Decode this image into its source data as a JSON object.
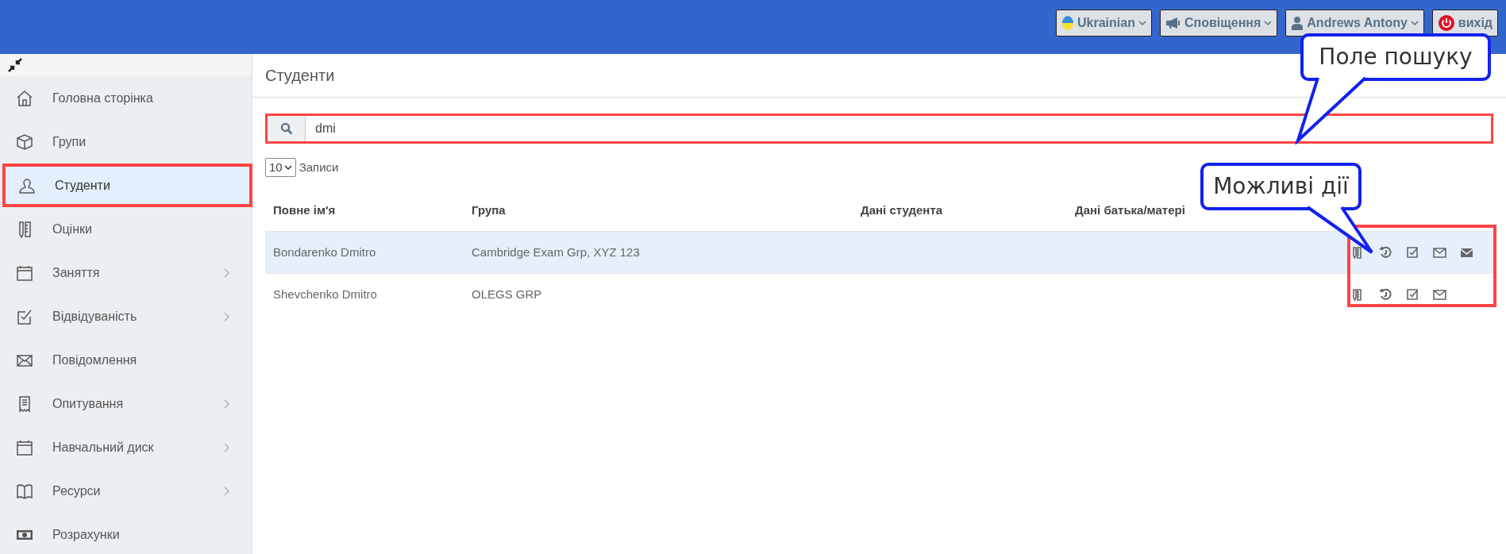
{
  "top_bar": {
    "buttons": [
      {
        "kind": "language",
        "label": "Ukrainian",
        "dropdown": true
      },
      {
        "kind": "notifications",
        "label": "Сповіщення",
        "dropdown": true
      },
      {
        "kind": "user",
        "label": "Andrews Antony",
        "dropdown": true
      },
      {
        "kind": "logout",
        "label": "вихід",
        "dropdown": false
      }
    ]
  },
  "sidebar": {
    "items": [
      {
        "kind": "home",
        "label": "Головна сторінка",
        "submenu": false,
        "selected": false,
        "highlighted": false
      },
      {
        "kind": "box",
        "label": "Групи",
        "submenu": false,
        "selected": false,
        "highlighted": false
      },
      {
        "kind": "user",
        "label": "Студенти",
        "submenu": false,
        "selected": true,
        "highlighted": true
      },
      {
        "kind": "grades",
        "label": "Оцінки",
        "submenu": false,
        "selected": false,
        "highlighted": false
      },
      {
        "kind": "calendar",
        "label": "Заняття",
        "submenu": true,
        "selected": false,
        "highlighted": false
      },
      {
        "kind": "check",
        "label": "Відвідуваність",
        "submenu": true,
        "selected": false,
        "highlighted": false
      },
      {
        "kind": "mail",
        "label": "Повідомлення",
        "submenu": false,
        "selected": false,
        "highlighted": false
      },
      {
        "kind": "receipt",
        "label": "Опитування",
        "submenu": true,
        "selected": false,
        "highlighted": false
      },
      {
        "kind": "calendar",
        "label": "Навчальний диск",
        "submenu": true,
        "selected": false,
        "highlighted": false
      },
      {
        "kind": "book",
        "label": "Ресурси",
        "submenu": true,
        "selected": false,
        "highlighted": false
      },
      {
        "kind": "money",
        "label": "Розрахунки",
        "submenu": false,
        "selected": false,
        "highlighted": false
      }
    ]
  },
  "page_title": "Студенти",
  "search": {
    "value": "dmi",
    "highlighted": true
  },
  "page_size": {
    "value": "10",
    "label": "Записи"
  },
  "table": {
    "columns": [
      "Повне ім'я",
      "Група",
      "Дані студента",
      "Дані батька/матері"
    ],
    "actions_highlighted": true,
    "rows": [
      {
        "cells": [
          "Bondarenko Dmitro",
          "Cambridge Exam Grp, XYZ 123",
          "",
          ""
        ],
        "hovered": true,
        "actions": [
          {
            "kind": "grades"
          },
          {
            "kind": "history"
          },
          {
            "kind": "attendance"
          },
          {
            "kind": "mail"
          },
          {
            "kind": "mail_filled"
          }
        ]
      },
      {
        "cells": [
          "Shevchenko Dmitro",
          "OLEGS GRP",
          "",
          ""
        ],
        "hovered": false,
        "actions": [
          {
            "kind": "grades"
          },
          {
            "kind": "history"
          },
          {
            "kind": "attendance"
          },
          {
            "kind": "mail"
          }
        ]
      }
    ]
  },
  "callouts": [
    {
      "text": "Поле пошуку"
    },
    {
      "text": "Можливі дії"
    }
  ]
}
